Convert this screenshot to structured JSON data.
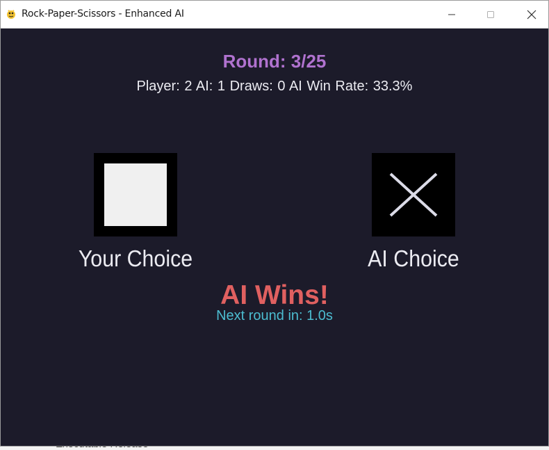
{
  "window": {
    "title": "Rock-Paper-Scissors - Enhanced AI",
    "app_icon": "pygame-snake-icon",
    "controls": [
      "minimize-icon",
      "maximize-icon",
      "close-icon"
    ]
  },
  "game": {
    "round_text": "Round: 3/25",
    "stats_text": "Player: 2  AI: 1  Draws: 0  AI Win Rate: 33.3%",
    "player": {
      "label": "Your Choice",
      "choice_icon": "paper-icon"
    },
    "ai": {
      "label": "AI Choice",
      "choice_icon": "scissors-icon"
    },
    "result_text": "AI Wins!",
    "next_round_text": "Next round in: 1.0s"
  },
  "colors": {
    "background": "#1c1b2a",
    "round": "#b072cf",
    "stats": "#ececf2",
    "result": "#e06060",
    "next_round": "#4cbcd0"
  },
  "background_text": "Executable Release"
}
